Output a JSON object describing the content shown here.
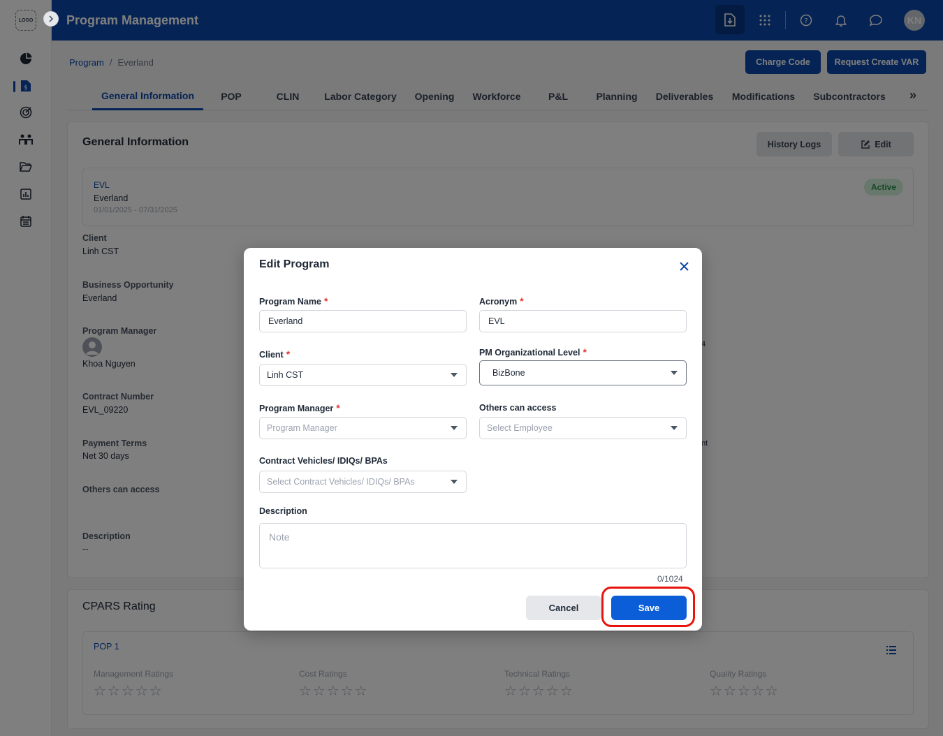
{
  "rail": {
    "logo_text": "LOGO"
  },
  "header": {
    "title": "Program Management",
    "avatar_initials": "KN"
  },
  "breadcrumb": {
    "root": "Program",
    "separator": "/",
    "current": "Everland"
  },
  "actions": {
    "charge_code": "Charge Code",
    "request_var": "Request Create VAR"
  },
  "tabs": [
    {
      "label": "General Information",
      "active": true
    },
    {
      "label": "POP"
    },
    {
      "label": "CLIN"
    },
    {
      "label": "Labor Category"
    },
    {
      "label": "Opening"
    },
    {
      "label": "Workforce"
    },
    {
      "label": "P&L"
    },
    {
      "label": "Planning"
    },
    {
      "label": "Deliverables"
    },
    {
      "label": "Modifications"
    },
    {
      "label": "Subcontractors"
    }
  ],
  "tabs_more": "»",
  "general": {
    "title": "General Information",
    "history_logs": "History Logs",
    "edit": "Edit",
    "summary": {
      "acronym": "EVL",
      "name": "Everland",
      "dates": "01/01/2025 - 07/31/2025",
      "status": "Active"
    },
    "fields": [
      {
        "label": "Client",
        "value": "Linh CST"
      },
      {
        "label": "Business Opportunity",
        "value": "Everland"
      },
      {
        "label": "Program Manager",
        "value": "Khoa Nguyen"
      },
      {
        "label": "Contract Number",
        "value": "EVL_09220"
      },
      {
        "label": "Payment Terms",
        "value": "Net 30 days"
      },
      {
        "label": "Others can access",
        "value": ""
      },
      {
        "label": "Description",
        "value": "--"
      }
    ],
    "peek_1": "4",
    "peek_2": "nt"
  },
  "cpars": {
    "title": "CPARS Rating",
    "pop_name": "POP 1",
    "ratings": [
      {
        "label": "Management Ratings",
        "stars": 0
      },
      {
        "label": "Cost Ratings",
        "stars": 0
      },
      {
        "label": "Technical Ratings",
        "stars": 0
      },
      {
        "label": "Quality Ratings",
        "stars": 0
      }
    ],
    "star_glyphs": "☆☆☆☆☆"
  },
  "modal": {
    "title": "Edit Program",
    "program_name": {
      "label": "Program Name",
      "value": "Everland"
    },
    "acronym": {
      "label": "Acronym",
      "value": "EVL"
    },
    "client": {
      "label": "Client",
      "value": "Linh CST"
    },
    "pm_level": {
      "label": "PM Organizational Level",
      "value": "BizBone"
    },
    "program_manager": {
      "label": "Program Manager",
      "placeholder": "Program Manager"
    },
    "others_access": {
      "label": "Others can access",
      "placeholder": "Select Employee"
    },
    "contract_vehicles": {
      "label": "Contract Vehicles/ IDIQs/ BPAs",
      "placeholder": "Select Contract Vehicles/ IDIQs/ BPAs"
    },
    "description": {
      "label": "Description",
      "placeholder": "Note",
      "counter": "0/1024"
    },
    "required_mark": "*",
    "cancel": "Cancel",
    "save": "Save"
  },
  "colors": {
    "brand": "#0b47a8",
    "save": "#0b5ed7",
    "highlight": "#e8140c",
    "active_badge": "#d1f0d9"
  }
}
